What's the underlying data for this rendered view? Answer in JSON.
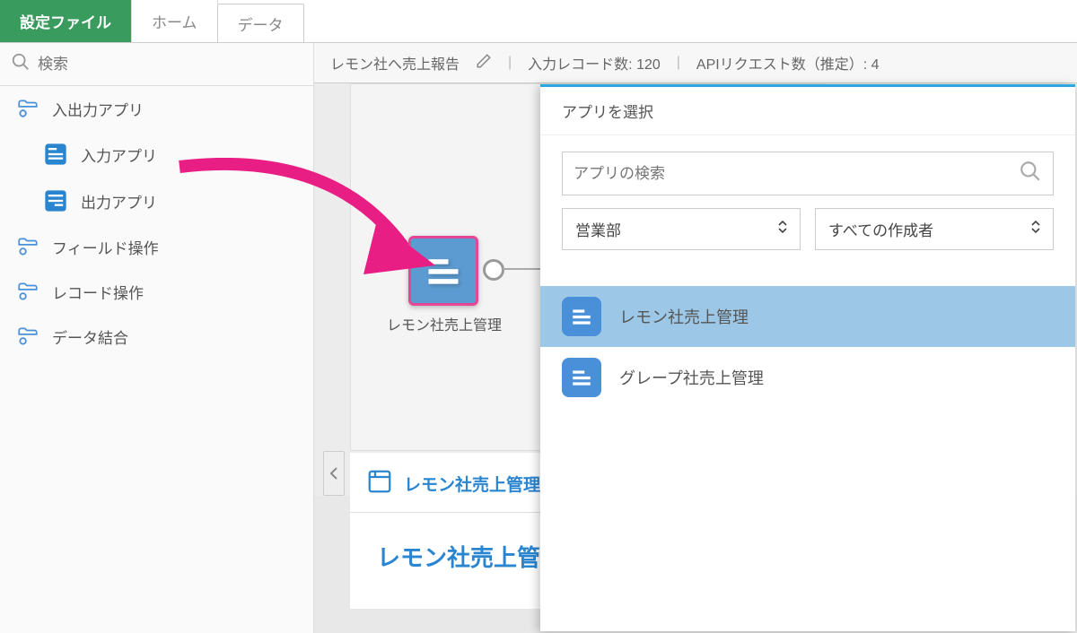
{
  "tabs": {
    "settings": "設定ファイル",
    "home": "ホーム",
    "data": "データ"
  },
  "sidebar": {
    "search_placeholder": "検索",
    "io_app": "入出力アプリ",
    "input_app": "入力アプリ",
    "output_app": "出力アプリ",
    "field_ops": "フィールド操作",
    "record_ops": "レコード操作",
    "data_join": "データ結合"
  },
  "status": {
    "title": "レモン社へ売上報告",
    "input_records": "入力レコード数: 120",
    "api_requests": "APIリクエスト数（推定）: 4"
  },
  "canvas": {
    "node_label": "レモン社売上管理",
    "panel_title": "レモン社売上管理",
    "panel_big": "レモン社売上管理"
  },
  "popup": {
    "title": "アプリを選択",
    "search_placeholder": "アプリの検索",
    "select1": "営業部",
    "select2": "すべての作成者",
    "apps": [
      {
        "name": "レモン社売上管理"
      },
      {
        "name": "グレープ社売上管理"
      }
    ]
  }
}
